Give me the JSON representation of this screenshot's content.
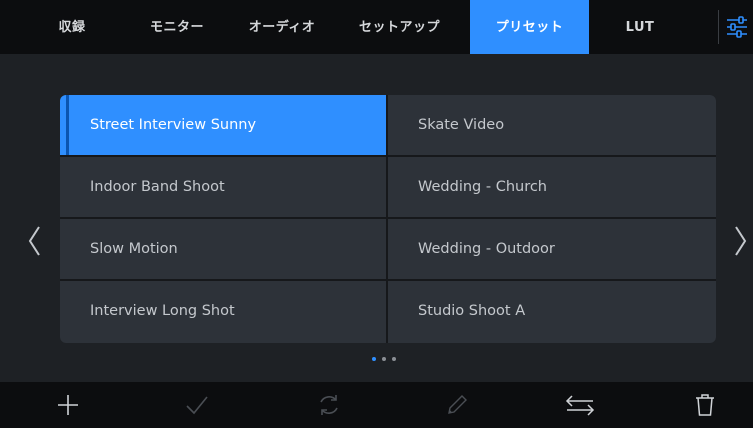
{
  "tabs": [
    {
      "label": "収録",
      "active": false
    },
    {
      "label": "モニター",
      "active": false
    },
    {
      "label": "オーディオ",
      "active": false
    },
    {
      "label": "セットアップ",
      "active": false
    },
    {
      "label": "プリセット",
      "active": true
    },
    {
      "label": "LUT",
      "active": false
    }
  ],
  "settings_icon": "sliders-icon",
  "presets": [
    {
      "name": "Street Interview Sunny",
      "selected": true
    },
    {
      "name": "Skate Video",
      "selected": false
    },
    {
      "name": "Indoor Band Shoot",
      "selected": false
    },
    {
      "name": "Wedding  - Church",
      "selected": false
    },
    {
      "name": "Slow Motion",
      "selected": false
    },
    {
      "name": "Wedding - Outdoor",
      "selected": false
    },
    {
      "name": "Interview Long Shot",
      "selected": false
    },
    {
      "name": "Studio Shoot A",
      "selected": false
    }
  ],
  "pagination": {
    "pages": 3,
    "current": 1
  },
  "toolbar": {
    "icons": [
      "plus-icon",
      "check-icon",
      "refresh-icon",
      "pencil-icon",
      "swap-icon",
      "trash-icon"
    ]
  },
  "colors": {
    "accent": "#2f8fff",
    "background": "#1e2125",
    "cell": "#2d3239",
    "bar": "#0c0d0f"
  }
}
